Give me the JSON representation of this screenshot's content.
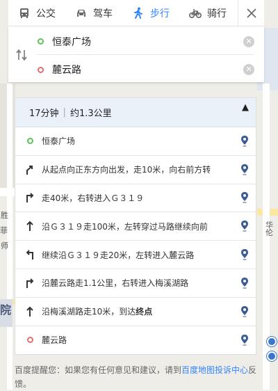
{
  "tabs": [
    {
      "label": "公交",
      "icon": "bus-icon",
      "active": false
    },
    {
      "label": "驾车",
      "icon": "car-icon",
      "active": false
    },
    {
      "label": "步行",
      "icon": "walk-icon",
      "active": true
    },
    {
      "label": "骑行",
      "icon": "bike-icon",
      "active": false
    }
  ],
  "endpoints": {
    "start": "恒泰广场",
    "end": "麓云路"
  },
  "summary": {
    "duration": "17分钟",
    "distance": "约1.3公里"
  },
  "steps": [
    {
      "type": "start",
      "text": "恒泰广场"
    },
    {
      "type": "right-slight",
      "text": "从起点向正东方向出发，走10米，向右前方转"
    },
    {
      "type": "right",
      "text": "走40米，右转进入Ｇ３１９"
    },
    {
      "type": "straight",
      "text": "沿Ｇ３１９走100米，左转穿过马路继续向前"
    },
    {
      "type": "left",
      "text": "继续沿Ｇ３１９走20米，左转进入麓云路"
    },
    {
      "type": "right",
      "text": "沿麓云路走1.1公里，右转进入梅溪湖路"
    },
    {
      "type": "straight",
      "text_pre": "沿梅溪湖路走10米，到达",
      "text_bold": "终点"
    },
    {
      "type": "end",
      "text": "麓云路"
    }
  ],
  "footer": {
    "prefix": "百度提醒您：如果您有任何意见和建议，请到",
    "link": "百度地图投诉中心",
    "suffix": "反馈。"
  },
  "map_labels": {
    "l1": "华伦",
    "l2": "院",
    "l3": "菲",
    "l4": "胜",
    "l5": "师"
  },
  "colors": {
    "accent": "#3385ff",
    "start": "#5cc15c",
    "end": "#e26e6e",
    "summary_bg": "#ebf1f9"
  }
}
